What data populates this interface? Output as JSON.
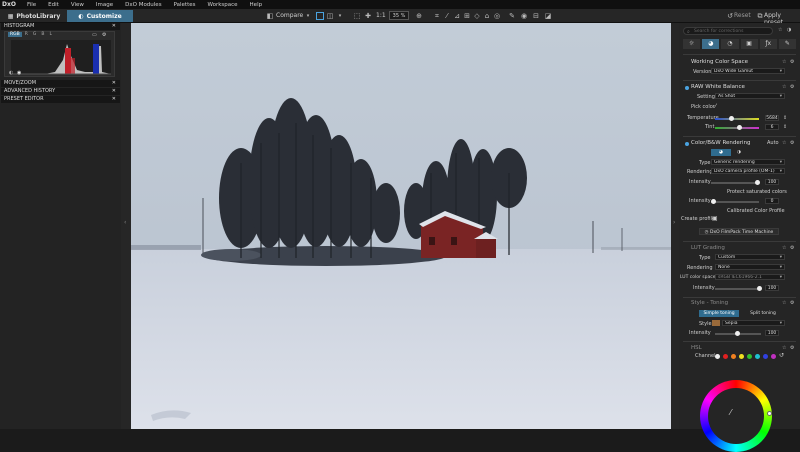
{
  "app": {
    "logo": "DxO"
  },
  "menu": [
    "File",
    "Edit",
    "View",
    "Image",
    "DxO Modules",
    "Palettes",
    "Workspace",
    "Help"
  ],
  "tabs": {
    "library": "PhotoLibrary",
    "customize": "Customize"
  },
  "toolbar": {
    "compare": "Compare",
    "one_to_one": "1:1",
    "zoom": "35 %",
    "reset": "Reset",
    "apply_preset": "Apply preset"
  },
  "left": {
    "histogram": "HISTOGRAM",
    "channels": [
      "RGB",
      "R",
      "G",
      "B",
      "L"
    ],
    "move_zoom": "MOVE/ZOOM",
    "advanced_history": "ADVANCED HISTORY",
    "preset_editor": "PRESET EDITOR"
  },
  "right": {
    "search_placeholder": "Search for corrections",
    "working_color_space": {
      "title": "Working Color Space",
      "version_label": "Version",
      "version_value": "DxO Wide Gamut"
    },
    "white_balance": {
      "title": "RAW White Balance",
      "setting_label": "Setting",
      "setting_value": "As Shot",
      "pick_label": "Pick color",
      "temp_label": "Temperature",
      "temp_value": "5684",
      "tint_label": "Tint",
      "tint_value": "6"
    },
    "color_rendering": {
      "title": "Color/B&W Rendering",
      "auto": "Auto",
      "type_label": "Type",
      "type_value": "Generic rendering",
      "rendering_label": "Rendering",
      "rendering_value": "DxO camera profile (OM-1)",
      "intensity_label": "Intensity",
      "intensity_value": "100",
      "protect": "Protect saturated colors",
      "intensity2_value": "0",
      "calibrated": "Calibrated Color Profile",
      "create_profile": "Create profile",
      "filmpack": "DxO FilmPack Time Machine"
    },
    "lut": {
      "title": "LUT Grading",
      "type_label": "Type",
      "type_value": "Custom",
      "rendering_label": "Rendering",
      "rendering_value": "None",
      "color_space_label": "LUT color space",
      "color_space_value": "sRGB IEC61966-2.1",
      "intensity_label": "Intensity",
      "intensity_value": "100"
    },
    "style": {
      "title": "Style - Toning",
      "simple": "Simple toning",
      "split": "Split toning",
      "style_label": "Style",
      "style_value": "Sepia",
      "intensity_label": "Intensity",
      "intensity_value": "100"
    },
    "hsl": {
      "title": "HSL",
      "channel_label": "Channel"
    }
  },
  "colors": {
    "accent": "#3c6e8c",
    "tab_active": "#3c6e8c",
    "sky": "#c6cfd9",
    "snow": "#d8dde8",
    "barn": "#8a2a2a"
  }
}
